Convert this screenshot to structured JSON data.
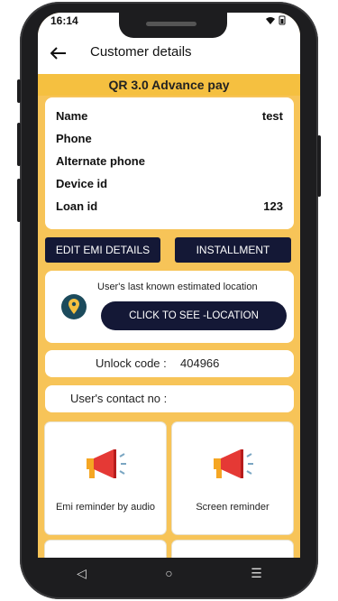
{
  "status": {
    "time": "16:14",
    "icons": "wifi-icon battery-icon"
  },
  "header": {
    "title": "Customer details",
    "back_icon": "back-arrow-icon"
  },
  "banner": {
    "text": "QR 3.0 Advance pay"
  },
  "customer": {
    "rows": [
      {
        "label": "Name",
        "value": "test"
      },
      {
        "label": "Phone",
        "value": ""
      },
      {
        "label": "Alternate phone",
        "value": ""
      },
      {
        "label": "Device id",
        "value": ""
      },
      {
        "label": "Loan id",
        "value": "123"
      }
    ]
  },
  "actions": {
    "edit_emi": "EDIT EMI DETAILS",
    "installment": "INSTALLMENT"
  },
  "location": {
    "text": "User's last known estimated location",
    "button": "CLICK TO SEE -LOCATION",
    "icon": "location-pin-icon"
  },
  "unlock": {
    "label": "Unlock code :",
    "value": "404966"
  },
  "contact": {
    "label": "User's contact no :"
  },
  "tiles": [
    {
      "label": "Emi reminder by audio",
      "icon": "megaphone-icon"
    },
    {
      "label": "Screen reminder",
      "icon": "megaphone-icon"
    }
  ],
  "nav": {
    "back": "◁",
    "home": "○",
    "recents": "☰"
  },
  "colors": {
    "accent": "#F7C458",
    "dark_button": "#141836",
    "megaphone": "#E53935"
  }
}
